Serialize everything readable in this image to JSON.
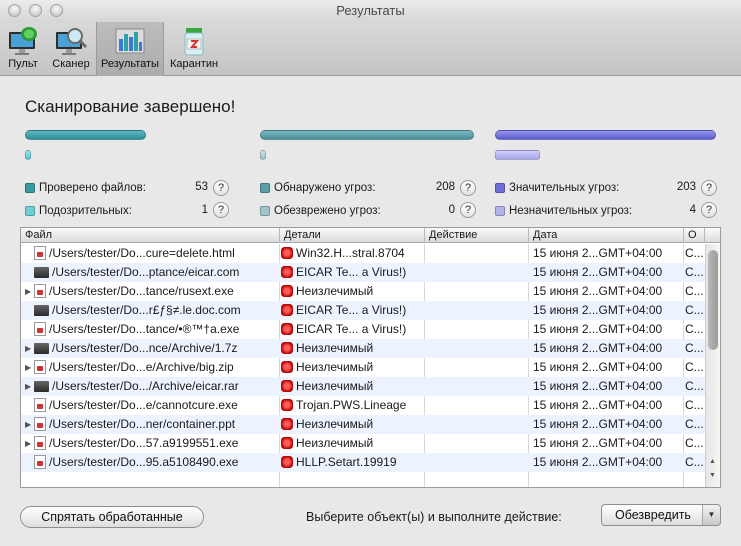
{
  "window": {
    "title": "Результаты"
  },
  "toolbar": {
    "items": [
      {
        "label": "Пульт",
        "icon": "monitor-bug-icon"
      },
      {
        "label": "Сканер",
        "icon": "monitor-magnifier-icon"
      },
      {
        "label": "Результаты",
        "icon": "bar-chart-icon",
        "active": true
      },
      {
        "label": "Карантин",
        "icon": "quarantine-jar-icon"
      }
    ]
  },
  "heading": "Сканирование завершено!",
  "colors": {
    "checked": "#3a9aa4",
    "suspicious": "#6fd0d8",
    "found": "#5aa0ab",
    "neutralized": "#9fc6cd",
    "significant": "#6e6ed8",
    "insignificant": "#b3b3ee"
  },
  "stats": {
    "checked_label": "Проверено файлов:",
    "checked_value": "53",
    "suspicious_label": "Подозрительных:",
    "suspicious_value": "1",
    "found_label": "Обнаружено угроз:",
    "found_value": "208",
    "neutralized_label": "Обезврежено угроз:",
    "neutralized_value": "0",
    "significant_label": "Значительных угроз:",
    "significant_value": "203",
    "insignificant_label": "Незначительных угроз:",
    "insignificant_value": "4",
    "help": "?"
  },
  "table": {
    "columns": [
      "Файл",
      "Детали",
      "Действие",
      "Дата",
      "О"
    ],
    "rows": [
      {
        "expand": "",
        "ficon": "doc",
        "file": "/Users/tester/Do...cure=delete.html",
        "details": "Win32.H...stral.8704",
        "action": "",
        "date": "15 июня 2...GMT+04:00",
        "o": "C..."
      },
      {
        "expand": "",
        "ficon": "black",
        "file": "/Users/tester/Do...ptance/eicar.com",
        "details": "EICAR Te... a Virus!)",
        "action": "",
        "date": "15 июня 2...GMT+04:00",
        "o": "C..."
      },
      {
        "expand": "▶",
        "ficon": "doc",
        "file": "/Users/tester/Do...tance/rusext.exe",
        "details": "Неизлечимый",
        "action": "",
        "date": "15 июня 2...GMT+04:00",
        "o": "C..."
      },
      {
        "expand": "",
        "ficon": "black",
        "file": "/Users/tester/Do...r£ƒ§≠.le.doc.com",
        "details": "EICAR Te... a Virus!)",
        "action": "",
        "date": "15 июня 2...GMT+04:00",
        "o": "C..."
      },
      {
        "expand": "",
        "ficon": "doc",
        "file": "/Users/tester/Do...tance/•®™†a.exe",
        "details": "EICAR Te... a Virus!)",
        "action": "",
        "date": "15 июня 2...GMT+04:00",
        "o": "C..."
      },
      {
        "expand": "▶",
        "ficon": "black",
        "file": "/Users/tester/Do...nce/Archive/1.7z",
        "details": "Неизлечимый",
        "action": "",
        "date": "15 июня 2...GMT+04:00",
        "o": "C..."
      },
      {
        "expand": "▶",
        "ficon": "doc",
        "file": "/Users/tester/Do...e/Archive/big.zip",
        "details": "Неизлечимый",
        "action": "",
        "date": "15 июня 2...GMT+04:00",
        "o": "C..."
      },
      {
        "expand": "▶",
        "ficon": "black",
        "file": "/Users/tester/Do.../Archive/eicar.rar",
        "details": "Неизлечимый",
        "action": "",
        "date": "15 июня 2...GMT+04:00",
        "o": "C..."
      },
      {
        "expand": "",
        "ficon": "doc",
        "file": "/Users/tester/Do...e/cannotcure.exe",
        "details": "Trojan.PWS.Lineage",
        "action": "",
        "date": "15 июня 2...GMT+04:00",
        "o": "C..."
      },
      {
        "expand": "▶",
        "ficon": "doc",
        "file": "/Users/tester/Do...ner/container.ppt",
        "details": "Неизлечимый",
        "action": "",
        "date": "15 июня 2...GMT+04:00",
        "o": "C..."
      },
      {
        "expand": "▶",
        "ficon": "doc",
        "file": "/Users/tester/Do...57.a9199551.exe",
        "details": "Неизлечимый",
        "action": "",
        "date": "15 июня 2...GMT+04:00",
        "o": "C..."
      },
      {
        "expand": "",
        "ficon": "doc",
        "file": "/Users/tester/Do...95.a5108490.exe",
        "details": "HLLP.Setart.19919",
        "action": "",
        "date": "15 июня 2...GMT+04:00",
        "o": "C..."
      }
    ]
  },
  "footer": {
    "hide_button": "Спрятать обработанные",
    "prompt": "Выберите объект(ы) и выполните действие:",
    "action_selected": "Обезвредить"
  }
}
